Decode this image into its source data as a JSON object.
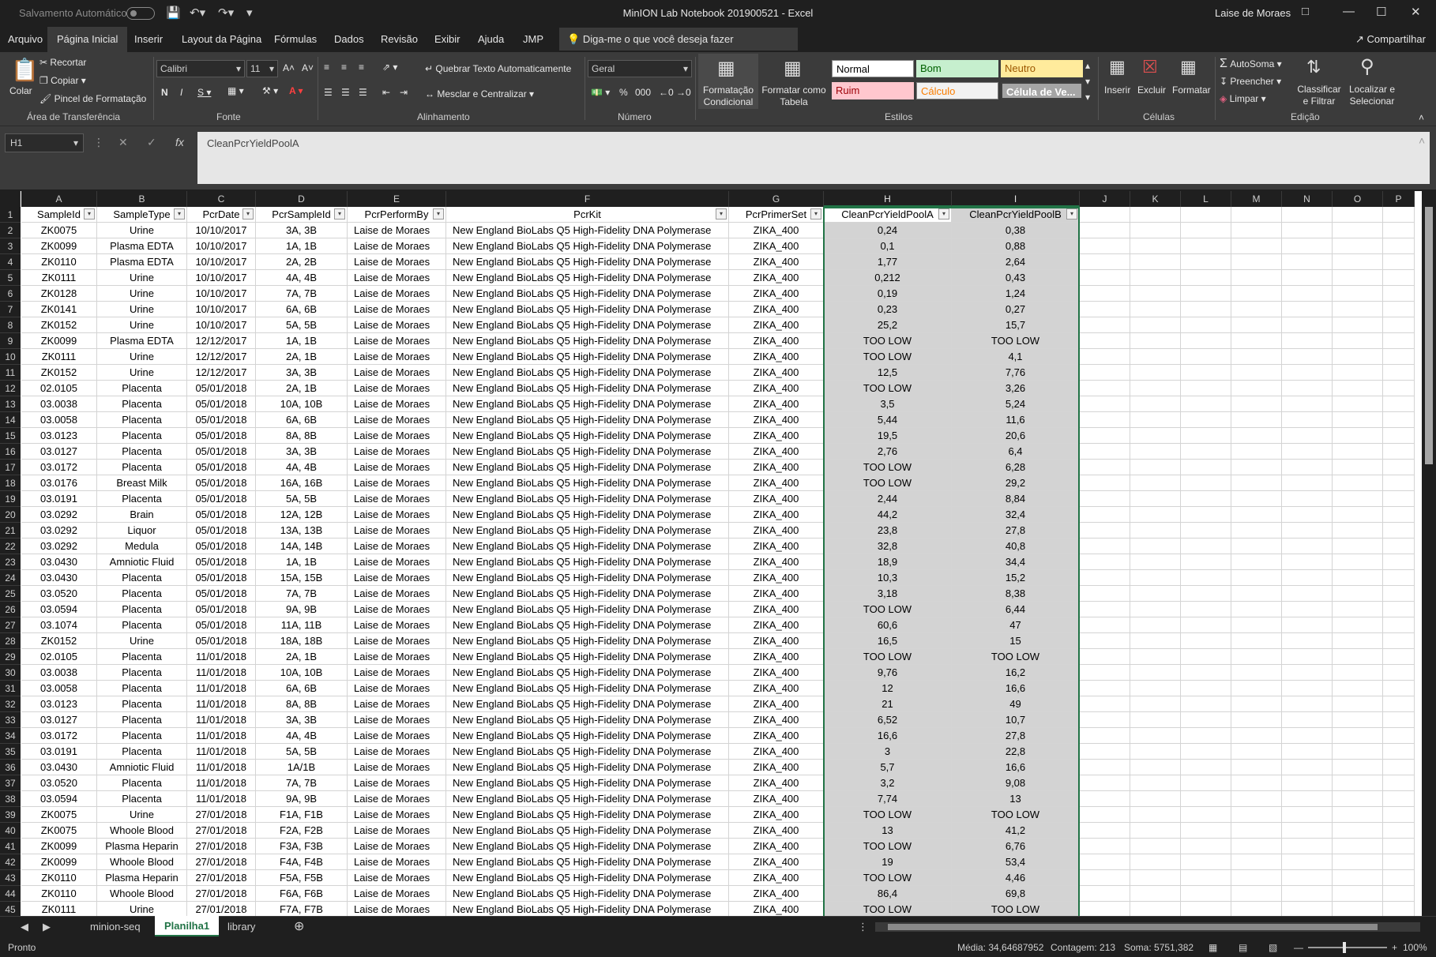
{
  "titlebar": {
    "autosave": "Salvamento Automático",
    "title": "MinION Lab Notebook 201900521  -  Excel",
    "user": "Laise de Moraes"
  },
  "tabs": [
    "Arquivo",
    "Página Inicial",
    "Inserir",
    "Layout da Página",
    "Fórmulas",
    "Dados",
    "Revisão",
    "Exibir",
    "Ajuda",
    "JMP"
  ],
  "tellme": "Diga-me o que você deseja fazer",
  "share": "Compartilhar",
  "ribbon": {
    "paste": "Colar",
    "cut": "Recortar",
    "copy": "Copiar",
    "format_painter": "Pincel de Formatação",
    "clipboard_group": "Área de Transferência",
    "font_name": "Calibri",
    "font_size": "11",
    "font_group": "Fonte",
    "wrap_text": "Quebrar Texto Automaticamente",
    "merge_center": "Mesclar e Centralizar",
    "alignment_group": "Alinhamento",
    "number_format": "Geral",
    "number_group": "Número",
    "conditional": "Formatação Condicional",
    "format_table": "Formatar como Tabela",
    "styles": [
      {
        "label": "Normal",
        "bg": "#ffffff",
        "fg": "#000000"
      },
      {
        "label": "Bom",
        "bg": "#c6efce",
        "fg": "#006100"
      },
      {
        "label": "Neutro",
        "bg": "#ffeb9c",
        "fg": "#9c5700"
      },
      {
        "label": "Ruim",
        "bg": "#ffc7ce",
        "fg": "#9c0006"
      },
      {
        "label": "Cálculo",
        "bg": "#f2f2f2",
        "fg": "#fa7d00"
      },
      {
        "label": "Célula de Ve...",
        "bg": "#a5a5a5",
        "fg": "#ffffff"
      }
    ],
    "styles_group": "Estilos",
    "insert": "Inserir",
    "delete": "Excluir",
    "format": "Formatar",
    "cells_group": "Células",
    "autosum": "AutoSoma",
    "fill": "Preencher",
    "clear": "Limpar",
    "sort_filter": "Classificar e Filtrar",
    "find_select": "Localizar e Selecionar",
    "editing_group": "Edição"
  },
  "formula": {
    "namebox": "H1",
    "content": "CleanPcrYieldPoolA"
  },
  "columns": [
    "A",
    "B",
    "C",
    "D",
    "E",
    "F",
    "G",
    "H",
    "I",
    "J",
    "K",
    "L",
    "M",
    "N",
    "O",
    "P"
  ],
  "headers": [
    "SampleId",
    "SampleType",
    "PcrDate",
    "PcrSampleId",
    "PcrPerformBy",
    "PcrKit",
    "PcrPrimerSet",
    "CleanPcrYieldPoolA",
    "CleanPcrYieldPoolB"
  ],
  "rows": [
    [
      "ZK0075",
      "Urine",
      "10/10/2017",
      "3A, 3B",
      "Laise de Moraes",
      "New England BioLabs Q5 High-Fidelity DNA Polymerase",
      "ZIKA_400",
      "0,24",
      "0,38"
    ],
    [
      "ZK0099",
      "Plasma EDTA",
      "10/10/2017",
      "1A, 1B",
      "Laise de Moraes",
      "New England BioLabs Q5 High-Fidelity DNA Polymerase",
      "ZIKA_400",
      "0,1",
      "0,88"
    ],
    [
      "ZK0110",
      "Plasma EDTA",
      "10/10/2017",
      "2A, 2B",
      "Laise de Moraes",
      "New England BioLabs Q5 High-Fidelity DNA Polymerase",
      "ZIKA_400",
      "1,77",
      "2,64"
    ],
    [
      "ZK0111",
      "Urine",
      "10/10/2017",
      "4A, 4B",
      "Laise de Moraes",
      "New England BioLabs Q5 High-Fidelity DNA Polymerase",
      "ZIKA_400",
      "0,212",
      "0,43"
    ],
    [
      "ZK0128",
      "Urine",
      "10/10/2017",
      "7A, 7B",
      "Laise de Moraes",
      "New England BioLabs Q5 High-Fidelity DNA Polymerase",
      "ZIKA_400",
      "0,19",
      "1,24"
    ],
    [
      "ZK0141",
      "Urine",
      "10/10/2017",
      "6A, 6B",
      "Laise de Moraes",
      "New England BioLabs Q5 High-Fidelity DNA Polymerase",
      "ZIKA_400",
      "0,23",
      "0,27"
    ],
    [
      "ZK0152",
      "Urine",
      "10/10/2017",
      "5A, 5B",
      "Laise de Moraes",
      "New England BioLabs Q5 High-Fidelity DNA Polymerase",
      "ZIKA_400",
      "25,2",
      "15,7"
    ],
    [
      "ZK0099",
      "Plasma EDTA",
      "12/12/2017",
      "1A, 1B",
      "Laise de Moraes",
      "New England BioLabs Q5 High-Fidelity DNA Polymerase",
      "ZIKA_400",
      "TOO LOW",
      "TOO LOW"
    ],
    [
      "ZK0111",
      "Urine",
      "12/12/2017",
      "2A, 1B",
      "Laise de Moraes",
      "New England BioLabs Q5 High-Fidelity DNA Polymerase",
      "ZIKA_400",
      "TOO LOW",
      "4,1"
    ],
    [
      "ZK0152",
      "Urine",
      "12/12/2017",
      "3A, 3B",
      "Laise de Moraes",
      "New England BioLabs Q5 High-Fidelity DNA Polymerase",
      "ZIKA_400",
      "12,5",
      "7,76"
    ],
    [
      "02.0105",
      "Placenta",
      "05/01/2018",
      "2A, 1B",
      "Laise de Moraes",
      "New England BioLabs Q5 High-Fidelity DNA Polymerase",
      "ZIKA_400",
      "TOO LOW",
      "3,26"
    ],
    [
      "03.0038",
      "Placenta",
      "05/01/2018",
      "10A, 10B",
      "Laise de Moraes",
      "New England BioLabs Q5 High-Fidelity DNA Polymerase",
      "ZIKA_400",
      "3,5",
      "5,24"
    ],
    [
      "03.0058",
      "Placenta",
      "05/01/2018",
      "6A, 6B",
      "Laise de Moraes",
      "New England BioLabs Q5 High-Fidelity DNA Polymerase",
      "ZIKA_400",
      "5,44",
      "11,6"
    ],
    [
      "03.0123",
      "Placenta",
      "05/01/2018",
      "8A, 8B",
      "Laise de Moraes",
      "New England BioLabs Q5 High-Fidelity DNA Polymerase",
      "ZIKA_400",
      "19,5",
      "20,6"
    ],
    [
      "03.0127",
      "Placenta",
      "05/01/2018",
      "3A, 3B",
      "Laise de Moraes",
      "New England BioLabs Q5 High-Fidelity DNA Polymerase",
      "ZIKA_400",
      "2,76",
      "6,4"
    ],
    [
      "03.0172",
      "Placenta",
      "05/01/2018",
      "4A, 4B",
      "Laise de Moraes",
      "New England BioLabs Q5 High-Fidelity DNA Polymerase",
      "ZIKA_400",
      "TOO LOW",
      "6,28"
    ],
    [
      "03.0176",
      "Breast Milk",
      "05/01/2018",
      "16A, 16B",
      "Laise de Moraes",
      "New England BioLabs Q5 High-Fidelity DNA Polymerase",
      "ZIKA_400",
      "TOO LOW",
      "29,2"
    ],
    [
      "03.0191",
      "Placenta",
      "05/01/2018",
      "5A, 5B",
      "Laise de Moraes",
      "New England BioLabs Q5 High-Fidelity DNA Polymerase",
      "ZIKA_400",
      "2,44",
      "8,84"
    ],
    [
      "03.0292",
      "Brain",
      "05/01/2018",
      "12A, 12B",
      "Laise de Moraes",
      "New England BioLabs Q5 High-Fidelity DNA Polymerase",
      "ZIKA_400",
      "44,2",
      "32,4"
    ],
    [
      "03.0292",
      "Liquor",
      "05/01/2018",
      "13A, 13B",
      "Laise de Moraes",
      "New England BioLabs Q5 High-Fidelity DNA Polymerase",
      "ZIKA_400",
      "23,8",
      "27,8"
    ],
    [
      "03.0292",
      "Medula",
      "05/01/2018",
      "14A, 14B",
      "Laise de Moraes",
      "New England BioLabs Q5 High-Fidelity DNA Polymerase",
      "ZIKA_400",
      "32,8",
      "40,8"
    ],
    [
      "03.0430",
      "Amniotic Fluid",
      "05/01/2018",
      "1A, 1B",
      "Laise de Moraes",
      "New England BioLabs Q5 High-Fidelity DNA Polymerase",
      "ZIKA_400",
      "18,9",
      "34,4"
    ],
    [
      "03.0430",
      "Placenta",
      "05/01/2018",
      "15A, 15B",
      "Laise de Moraes",
      "New England BioLabs Q5 High-Fidelity DNA Polymerase",
      "ZIKA_400",
      "10,3",
      "15,2"
    ],
    [
      "03.0520",
      "Placenta",
      "05/01/2018",
      "7A, 7B",
      "Laise de Moraes",
      "New England BioLabs Q5 High-Fidelity DNA Polymerase",
      "ZIKA_400",
      "3,18",
      "8,38"
    ],
    [
      "03.0594",
      "Placenta",
      "05/01/2018",
      "9A, 9B",
      "Laise de Moraes",
      "New England BioLabs Q5 High-Fidelity DNA Polymerase",
      "ZIKA_400",
      "TOO LOW",
      "6,44"
    ],
    [
      "03.1074",
      "Placenta",
      "05/01/2018",
      "11A, 11B",
      "Laise de Moraes",
      "New England BioLabs Q5 High-Fidelity DNA Polymerase",
      "ZIKA_400",
      "60,6",
      "47"
    ],
    [
      "ZK0152",
      "Urine",
      "05/01/2018",
      "18A, 18B",
      "Laise de Moraes",
      "New England BioLabs Q5 High-Fidelity DNA Polymerase",
      "ZIKA_400",
      "16,5",
      "15"
    ],
    [
      "02.0105",
      "Placenta",
      "11/01/2018",
      "2A, 1B",
      "Laise de Moraes",
      "New England BioLabs Q5 High-Fidelity DNA Polymerase",
      "ZIKA_400",
      "TOO LOW",
      "TOO LOW"
    ],
    [
      "03.0038",
      "Placenta",
      "11/01/2018",
      "10A, 10B",
      "Laise de Moraes",
      "New England BioLabs Q5 High-Fidelity DNA Polymerase",
      "ZIKA_400",
      "9,76",
      "16,2"
    ],
    [
      "03.0058",
      "Placenta",
      "11/01/2018",
      "6A, 6B",
      "Laise de Moraes",
      "New England BioLabs Q5 High-Fidelity DNA Polymerase",
      "ZIKA_400",
      "12",
      "16,6"
    ],
    [
      "03.0123",
      "Placenta",
      "11/01/2018",
      "8A, 8B",
      "Laise de Moraes",
      "New England BioLabs Q5 High-Fidelity DNA Polymerase",
      "ZIKA_400",
      "21",
      "49"
    ],
    [
      "03.0127",
      "Placenta",
      "11/01/2018",
      "3A, 3B",
      "Laise de Moraes",
      "New England BioLabs Q5 High-Fidelity DNA Polymerase",
      "ZIKA_400",
      "6,52",
      "10,7"
    ],
    [
      "03.0172",
      "Placenta",
      "11/01/2018",
      "4A, 4B",
      "Laise de Moraes",
      "New England BioLabs Q5 High-Fidelity DNA Polymerase",
      "ZIKA_400",
      "16,6",
      "27,8"
    ],
    [
      "03.0191",
      "Placenta",
      "11/01/2018",
      "5A, 5B",
      "Laise de Moraes",
      "New England BioLabs Q5 High-Fidelity DNA Polymerase",
      "ZIKA_400",
      "3",
      "22,8"
    ],
    [
      "03.0430",
      "Amniotic Fluid",
      "11/01/2018",
      "1A/1B",
      "Laise de Moraes",
      "New England BioLabs Q5 High-Fidelity DNA Polymerase",
      "ZIKA_400",
      "5,7",
      "16,6"
    ],
    [
      "03.0520",
      "Placenta",
      "11/01/2018",
      "7A, 7B",
      "Laise de Moraes",
      "New England BioLabs Q5 High-Fidelity DNA Polymerase",
      "ZIKA_400",
      "3,2",
      "9,08"
    ],
    [
      "03.0594",
      "Placenta",
      "11/01/2018",
      "9A, 9B",
      "Laise de Moraes",
      "New England BioLabs Q5 High-Fidelity DNA Polymerase",
      "ZIKA_400",
      "7,74",
      "13"
    ],
    [
      "ZK0075",
      "Urine",
      "27/01/2018",
      "F1A, F1B",
      "Laise de Moraes",
      "New England BioLabs Q5 High-Fidelity DNA Polymerase",
      "ZIKA_400",
      "TOO LOW",
      "TOO LOW"
    ],
    [
      "ZK0075",
      "Whoole Blood",
      "27/01/2018",
      "F2A, F2B",
      "Laise de Moraes",
      "New England BioLabs Q5 High-Fidelity DNA Polymerase",
      "ZIKA_400",
      "13",
      "41,2"
    ],
    [
      "ZK0099",
      "Plasma Heparin",
      "27/01/2018",
      "F3A, F3B",
      "Laise de Moraes",
      "New England BioLabs Q5 High-Fidelity DNA Polymerase",
      "ZIKA_400",
      "TOO LOW",
      "6,76"
    ],
    [
      "ZK0099",
      "Whoole Blood",
      "27/01/2018",
      "F4A, F4B",
      "Laise de Moraes",
      "New England BioLabs Q5 High-Fidelity DNA Polymerase",
      "ZIKA_400",
      "19",
      "53,4"
    ],
    [
      "ZK0110",
      "Plasma Heparin",
      "27/01/2018",
      "F5A, F5B",
      "Laise de Moraes",
      "New England BioLabs Q5 High-Fidelity DNA Polymerase",
      "ZIKA_400",
      "TOO LOW",
      "4,46"
    ],
    [
      "ZK0110",
      "Whoole Blood",
      "27/01/2018",
      "F6A, F6B",
      "Laise de Moraes",
      "New England BioLabs Q5 High-Fidelity DNA Polymerase",
      "ZIKA_400",
      "86,4",
      "69,8"
    ],
    [
      "ZK0111",
      "Urine",
      "27/01/2018",
      "F7A, F7B",
      "Laise de Moraes",
      "New England BioLabs Q5 High-Fidelity DNA Polymerase",
      "ZIKA_400",
      "TOO LOW",
      "TOO LOW"
    ]
  ],
  "sheets": [
    "minion-seq",
    "Planilha1",
    "library"
  ],
  "status": {
    "ready": "Pronto",
    "average": "Média: 34,64687952",
    "count": "Contagem: 213",
    "sum": "Soma: 5751,382",
    "zoom": "100%"
  }
}
